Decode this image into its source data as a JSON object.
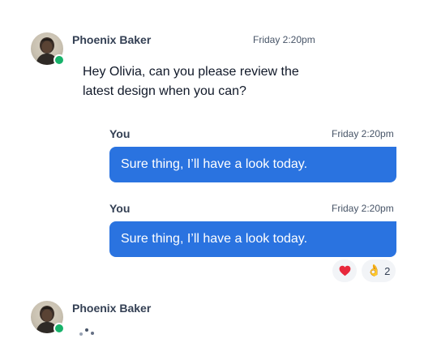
{
  "thread": {
    "incoming_1": {
      "sender": "Phoenix Baker",
      "time": "Friday 2:20pm",
      "text": "Hey Olivia, can you please review the latest design when you can?",
      "avatar": "avatar-photo-icon",
      "online": true
    },
    "outgoing_1": {
      "sender": "You",
      "time": "Friday 2:20pm",
      "text": "Sure thing, I’ll have a look today."
    },
    "outgoing_2": {
      "sender": "You",
      "time": "Friday 2:20pm",
      "text": "Sure thing, I’ll have a look today.",
      "reactions": [
        {
          "emoji": "❤️",
          "icon": "heart-icon",
          "count": ""
        },
        {
          "emoji": "👌",
          "icon": "ok-hand-icon",
          "count": "2"
        }
      ]
    },
    "typing": {
      "sender": "Phoenix Baker",
      "avatar": "avatar-photo-icon",
      "online": true
    }
  },
  "colors": {
    "bubble": "#2a73e0",
    "online": "#17b26a",
    "reaction_bg": "#f2f4f7",
    "heart": "#e8283b"
  }
}
